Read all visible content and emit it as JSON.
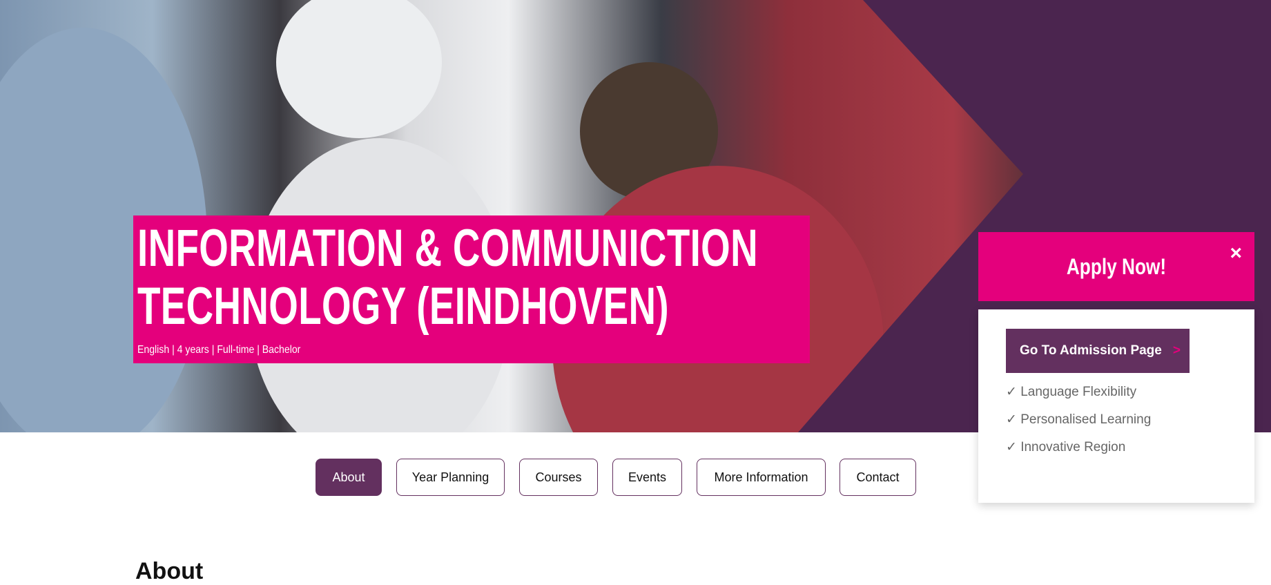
{
  "hero": {
    "title_line1": "INFORMATION & COMMUNICTION",
    "title_line2": "TECHNOLOGY (EINDHOVEN)",
    "subtitle": "English | 4 years | Full-time | Bachelor"
  },
  "apply_popup": {
    "title": "Apply Now!",
    "close_icon": "×",
    "admission_button": "Go To Admission Page",
    "admission_arrow": ">",
    "benefits": [
      "✓ Language Flexibility",
      "✓ Personalised Learning",
      "✓ Innovative Region"
    ]
  },
  "tabs": [
    {
      "label": "About",
      "active": true
    },
    {
      "label": "Year Planning"
    },
    {
      "label": "Courses"
    },
    {
      "label": "Events"
    },
    {
      "label": "More Information"
    },
    {
      "label": "Contact"
    }
  ],
  "section_heading": "About",
  "colors": {
    "brand_pink": "#e4007c",
    "brand_purple": "#63305f",
    "panel_purple": "#4b254f"
  }
}
